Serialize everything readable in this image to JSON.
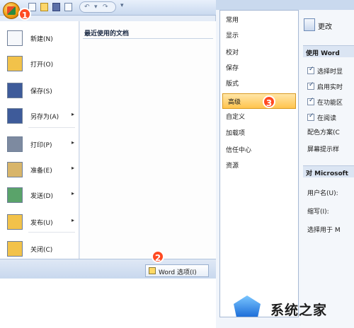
{
  "office_menu": {
    "items": [
      {
        "label": "新建(N)",
        "icon": "new-document-icon",
        "submenu": false
      },
      {
        "label": "打开(O)",
        "icon": "open-folder-icon",
        "submenu": false
      },
      {
        "label": "保存(S)",
        "icon": "save-icon",
        "submenu": false
      },
      {
        "label": "另存为(A)",
        "icon": "save-as-icon",
        "submenu": true
      },
      {
        "label": "打印(P)",
        "icon": "print-icon",
        "submenu": true
      },
      {
        "label": "准备(E)",
        "icon": "prepare-icon",
        "submenu": true
      },
      {
        "label": "发送(D)",
        "icon": "send-icon",
        "submenu": true
      },
      {
        "label": "发布(U)",
        "icon": "publish-icon",
        "submenu": true
      },
      {
        "label": "关闭(C)",
        "icon": "close-folder-icon",
        "submenu": false
      }
    ],
    "recent_title": "最近使用的文档",
    "word_options_button": "Word 选项(I)"
  },
  "markers": {
    "step1": "1",
    "step2": "2",
    "step3": "3"
  },
  "dialog": {
    "categories": [
      "常用",
      "显示",
      "校对",
      "保存",
      "版式",
      "高级",
      "自定义",
      "加载项",
      "信任中心",
      "资源"
    ],
    "selected_category": "高级",
    "header_text": "更改",
    "section1_title": "使用 Word",
    "options": [
      {
        "label": "选择时显",
        "checked": true
      },
      {
        "label": "启用实时",
        "checked": true
      },
      {
        "label": "在功能区",
        "checked": true
      },
      {
        "label": "在阅读",
        "checked": true
      }
    ],
    "color_scheme_label": "配色方案(C",
    "screentip_label": "屏幕提示样",
    "section2_title": "对 Microsoft",
    "username_label": "用户名(U):",
    "initials_label": "缩写(I):",
    "choose_label": "选择用于 M"
  },
  "watermark": {
    "text": "系统之家"
  }
}
